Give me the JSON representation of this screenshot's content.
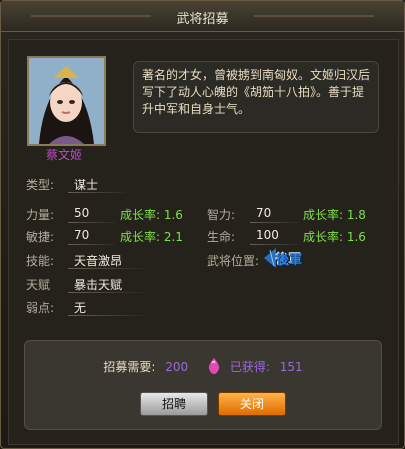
{
  "window": {
    "title": "武将招募"
  },
  "general": {
    "name": "蔡文姬",
    "description": "著名的才女，曾被掳到南匈奴。文姬归汉后写下了动人心魄的《胡笳十八拍》。善于提升中军和自身士气。"
  },
  "stats": {
    "type_label": "类型:",
    "type_value": "谋士",
    "strength_label": "力量:",
    "strength_value": "50",
    "strength_growth": "成长率: 1.6",
    "intellect_label": "智力:",
    "intellect_value": "70",
    "intellect_growth": "成长率: 1.8",
    "agility_label": "敏捷:",
    "agility_value": "70",
    "agility_growth": "成长率: 2.1",
    "hp_label": "生命:",
    "hp_value": "100",
    "hp_growth": "成长率: 1.6",
    "skill_label": "技能:",
    "skill_value": "天音激昂",
    "talent_label": "天赋",
    "talent_value": "暴击天赋",
    "weakness_label": "弱点:",
    "weakness_value": "无",
    "position_label": "武将位置:",
    "position_badge": "後軍"
  },
  "recruit": {
    "need_label": "招募需要:",
    "need_value": "200",
    "obtained_label": "已获得:",
    "obtained_value": "151"
  },
  "buttons": {
    "recruit": "招聘",
    "close": "关闭"
  },
  "colors": {
    "accent_green": "#7ee04a",
    "name_purple": "#b64ec4",
    "count_purple": "#9a6bd8",
    "close_orange": "#f08a1c"
  }
}
